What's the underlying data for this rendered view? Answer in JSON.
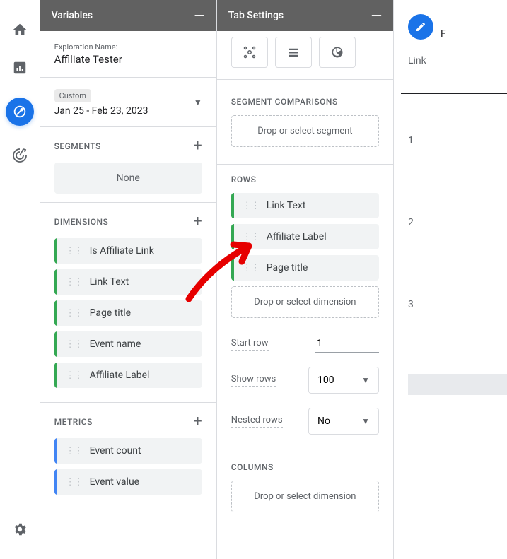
{
  "panels": {
    "variables": {
      "title": "Variables"
    },
    "tab_settings": {
      "title": "Tab Settings"
    }
  },
  "exploration": {
    "label": "Exploration Name:",
    "name": "Affiliate Tester"
  },
  "date": {
    "badge": "Custom",
    "range": "Jan 25 - Feb 23, 2023"
  },
  "segments": {
    "title": "SEGMENTS",
    "empty": "None"
  },
  "dimensions": {
    "title": "DIMENSIONS",
    "items": [
      "Is Affiliate Link",
      "Link Text",
      "Page title",
      "Event name",
      "Affiliate Label"
    ]
  },
  "metrics": {
    "title": "METRICS",
    "items": [
      "Event count",
      "Event value"
    ]
  },
  "segment_comparisons": {
    "title": "SEGMENT COMPARISONS",
    "drop": "Drop or select segment"
  },
  "rows": {
    "title": "ROWS",
    "items": [
      "Link Text",
      "Affiliate Label",
      "Page title"
    ],
    "drop": "Drop or select dimension"
  },
  "start_row": {
    "label": "Start row",
    "value": "1"
  },
  "show_rows": {
    "label": "Show rows",
    "value": "100"
  },
  "nested_rows": {
    "label": "Nested rows",
    "value": "No"
  },
  "columns": {
    "title": "COLUMNS",
    "drop": "Drop or select dimension"
  },
  "results": {
    "header": "Link",
    "partial": "F",
    "rows": [
      "1",
      "2",
      "3"
    ]
  }
}
